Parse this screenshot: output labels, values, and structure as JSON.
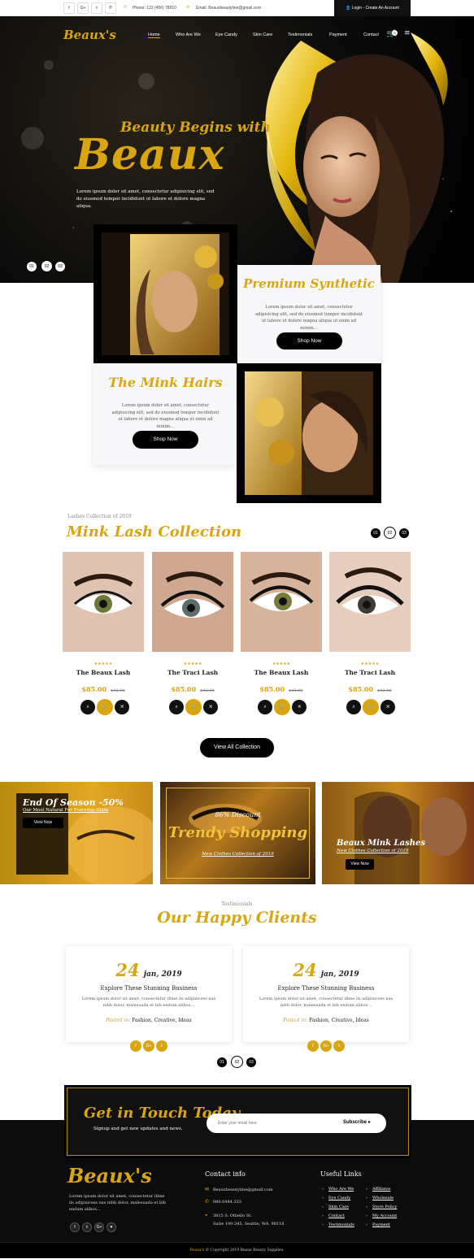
{
  "topbar": {
    "social": [
      "f",
      "G+",
      "𝕥",
      "P"
    ],
    "phone": "Phone: 123 (456) 78910",
    "email": "Email: Beauxbeautyline@gmail.com",
    "login": "Login",
    "sep": "-",
    "create": "Create An Account"
  },
  "brand": {
    "logo": "Beaux's"
  },
  "nav": {
    "items": [
      "Home",
      "Who Are We",
      "Eye Candy",
      "Skin Care",
      "Testimonials",
      "Payment",
      "Contact"
    ],
    "cart_count": "0"
  },
  "hero": {
    "line1": "Beauty Begins with",
    "line2": "Beaux",
    "text": "Lorem ipsum dolor sit amet, consectetur adipisicing elit, sed do eiusmod tempor incididunt ut labore et dolore magna aliqua.",
    "pager": [
      "01",
      "02",
      "03"
    ]
  },
  "promo": {
    "premium": {
      "title": "Premium Synthetic",
      "text": "Lorem ipsum dolor sit amet, consectetur adipisicing elit, sed do eiusmod tempor incididunt ut labore et dolore magna aliqua ut enim ad minim…",
      "button": "Shop Now"
    },
    "mink": {
      "title": "The Mink Hairs",
      "text": "Lorem ipsum dolor sit amet, consectetur adipisicing elit, sed do eiusmod tempor incididunt ut labore et dolore magna aliqua ut enim ad minim…",
      "button": "Shop Now"
    }
  },
  "collection": {
    "subtitle": "Lashes Collection of 2019",
    "title": "Mink Lash Collection",
    "pager": [
      "01",
      "02",
      "03"
    ],
    "products": [
      {
        "name": "The Beaux Lash",
        "price": "$85.00",
        "old": "$42.00",
        "stars": "★★★★★"
      },
      {
        "name": "The Traci Lash",
        "price": "$85.00",
        "old": "$42.00",
        "stars": "★★★★★"
      },
      {
        "name": "The Beaux Lash",
        "price": "$85.00",
        "old": "$42.00",
        "stars": "★★★★★"
      },
      {
        "name": "The Traci Lash",
        "price": "$85.00",
        "old": "$42.00",
        "stars": "★★★★★"
      }
    ],
    "view_all": "View All Collection"
  },
  "banners": {
    "b1": {
      "title": "End Of Season -50%",
      "sub": "Our Most Natural For Everyday Glam",
      "button": "View Now"
    },
    "b2": {
      "pre": "86% Discount",
      "title": "Trendy Shopping",
      "sub": "New Clothes Collection of 2019"
    },
    "b3": {
      "title": "Beaux Mink Lashes",
      "sub": "New Clothes Collection of 2019",
      "button": "View Now"
    }
  },
  "testimonials": {
    "subtitle": "Testimonials",
    "title": "Our Happy Clients",
    "items": [
      {
        "day": "24",
        "month": "jan, 2019",
        "title": "Explore These Stunning Business",
        "text": "Lorem ipsum dolor sit amet, consectetur illme ils adipisicess nas nibh dolor, malesuada et bib endum alibos…",
        "posted_label": "Posted in:",
        "tags": "Fashion, Creative, Ideas"
      },
      {
        "day": "24",
        "month": "jan, 2019",
        "title": "Explore These Stunning Business",
        "text": "Lorem ipsum dolor sit amet, consectetur illme ils adipisicess nas nibh dolor, malesuada et bib endum alibos…",
        "posted_label": "Posted in:",
        "tags": "Fashion, Creative, Ideas"
      }
    ],
    "share": [
      "f",
      "G+",
      "𝕥"
    ],
    "pager": [
      "01",
      "02",
      "03"
    ]
  },
  "newsletter": {
    "title": "Get in Touch Today",
    "sub": "Signup and get new updates and news.",
    "placeholder": "Enter your email here",
    "button": "Subscribe"
  },
  "footer": {
    "logo": "Beaux's",
    "about": "Lorem ipsum dolor sit amet, consectetur illme ils adipisicess nas nibh dolor, malesuada et bib endum alibos…",
    "social": [
      "f",
      "𝕥",
      "G+",
      "♥"
    ],
    "contact_title": "Contact info",
    "email": "Beauxbeautyline@gmail.com",
    "phone": "080.0444.333",
    "address1": "3815 S. Othello St.",
    "address2": "Suite 100-345, Seattle, WA. 98118",
    "links_title": "Useful Links",
    "links_col1": [
      "Who Are We",
      "Eye Candy",
      "Skin Care",
      "Contact",
      "Testimonials"
    ],
    "links_col2": [
      "Affiliates",
      "Wholesale",
      "Store Policy",
      "My Account",
      "Payment"
    ],
    "copyright_brand": "Beaux's",
    "copyright": "© Copyright 2019 Beaux Beauty Supplies."
  }
}
